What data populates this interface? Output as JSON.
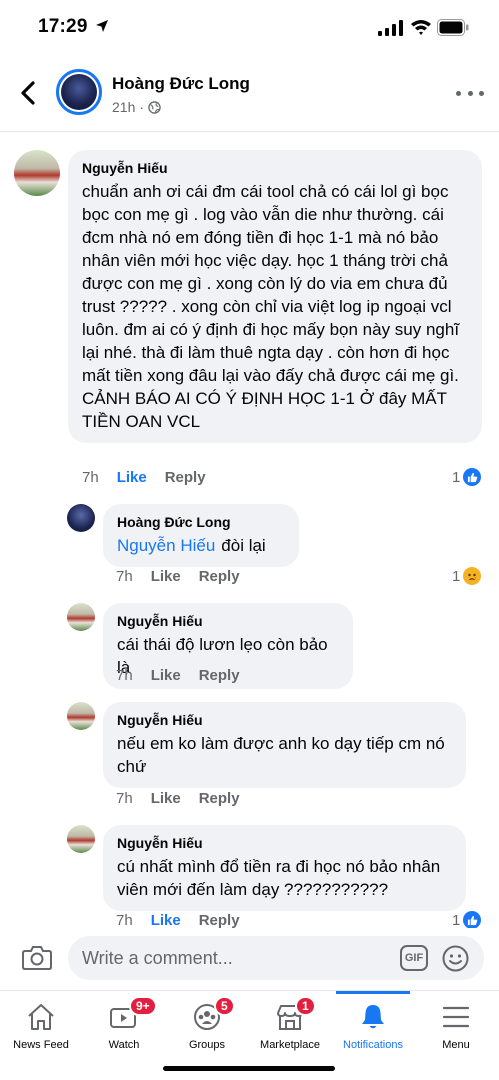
{
  "status_bar": {
    "time": "17:29"
  },
  "header": {
    "name": "Hoàng Đức Long",
    "time": "21h",
    "separator": "·"
  },
  "comments": [
    {
      "author": "Nguyễn Hiếu",
      "text": "chuẩn anh ơi cái đm cái tool chả có cái lol gì bọc bọc con mẹ gì . log vào vẫn die như thường. cái đcm nhà nó em đóng tiền đi học 1-1 mà nó bảo nhân viên mới học việc dạy. học 1 tháng trời chả được con mẹ gì . xong còn lý do via em chưa đủ trust ????? . xong còn chỉ via việt log ip ngoại vcl luôn. đm ai có ý định đi học mấy bọn này suy nghĩ lại nhé. thà đi làm thuê ngta dạy . còn hơn đi học mất tiền xong đâu lại vào đấy chả được cái mẹ gì. CẢNH BÁO AI CÓ Ý ĐỊNH HỌC 1-1 Ở đây MẤT TIỀN OAN VCL",
      "time": "7h",
      "like": "Like",
      "reply": "Reply",
      "reaction_count": "1",
      "reaction": "like"
    },
    {
      "author": "Hoàng Đức Long",
      "mention": "Nguyễn Hiếu",
      "text": "đòi lại",
      "time": "7h",
      "like": "Like",
      "reply": "Reply",
      "reaction_count": "1",
      "reaction": "sad"
    },
    {
      "author": "Nguyễn Hiếu",
      "text": "cái thái độ lươn lẹo còn bảo là",
      "time": "7h",
      "like": "Like",
      "reply": "Reply"
    },
    {
      "author": "Nguyễn Hiếu",
      "text": "nếu em ko làm được anh ko dạy tiếp cm nó chứ",
      "time": "7h",
      "like": "Like",
      "reply": "Reply"
    },
    {
      "author": "Nguyễn Hiếu",
      "text": "cú nhất mình đổ tiền ra đi học nó bảo nhân viên mới đến làm dạy ???????????",
      "time": "7h",
      "like": "Like",
      "reply": "Reply",
      "reaction_count": "1",
      "reaction": "like"
    }
  ],
  "composer": {
    "placeholder": "Write a comment...",
    "gif": "GIF"
  },
  "nav": [
    {
      "label": "News Feed",
      "icon": "home-icon"
    },
    {
      "label": "Watch",
      "icon": "watch-icon",
      "badge": "9+"
    },
    {
      "label": "Groups",
      "icon": "groups-icon",
      "badge": "5"
    },
    {
      "label": "Marketplace",
      "icon": "marketplace-icon",
      "badge": "1"
    },
    {
      "label": "Notifications",
      "icon": "bell-icon",
      "active": true
    },
    {
      "label": "Menu",
      "icon": "menu-icon"
    }
  ],
  "colors": {
    "accent": "#1877f2",
    "badge": "#e41e3f",
    "bubble": "#f0f2f5",
    "muted": "#65676b"
  }
}
